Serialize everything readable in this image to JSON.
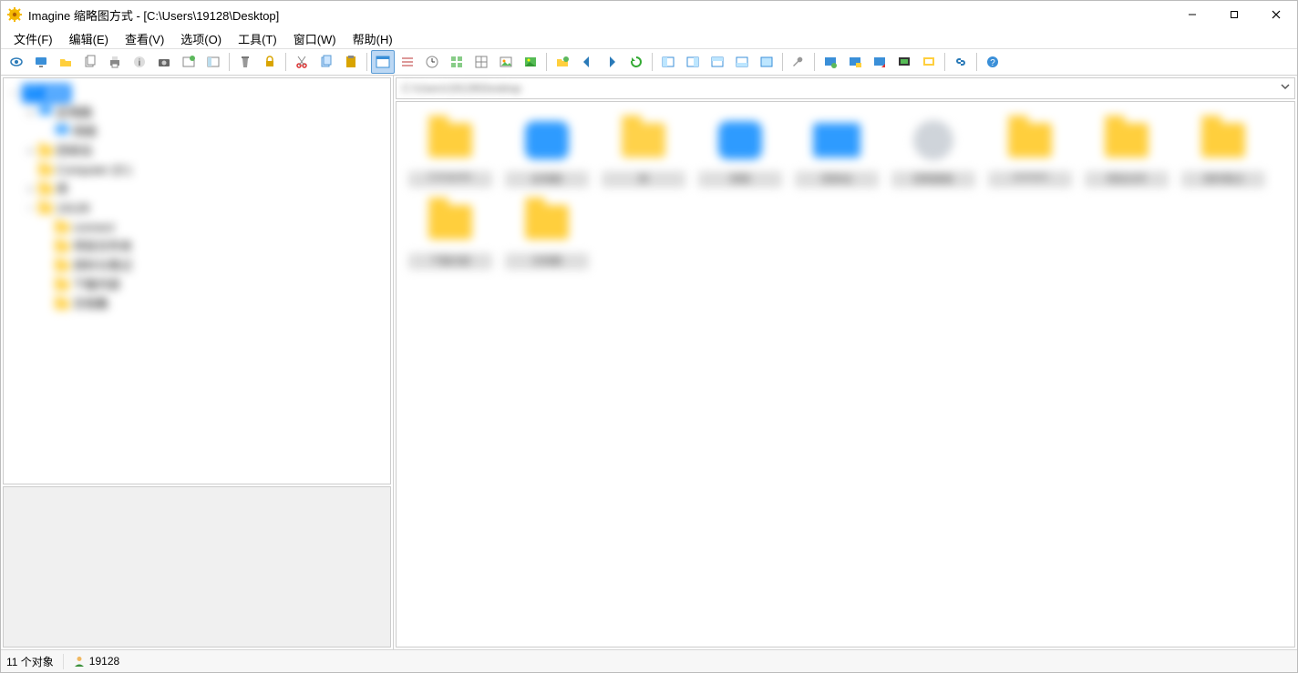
{
  "window": {
    "title": "Imagine 缩略图方式 - [C:\\Users\\19128\\Desktop]"
  },
  "menu": {
    "file": "文件(F)",
    "edit": "编辑(E)",
    "view": "查看(V)",
    "options": "选项(O)",
    "tools": "工具(T)",
    "window": "窗口(W)",
    "help": "帮助(H)"
  },
  "toolbar": {
    "groups": [
      [
        "view-icon",
        "monitor-icon",
        "folder-open-icon",
        "copy-icon",
        "print-icon",
        "info-icon",
        "camera-icon",
        "new-window-icon",
        "panel-icon"
      ],
      [
        "delete-icon",
        "lock-icon"
      ],
      [
        "cut-icon",
        "copy2-icon",
        "paste-icon"
      ],
      [
        "window-mode-icon",
        "list-icon",
        "clock-icon",
        "details-icon",
        "grid-icon",
        "image-icon",
        "scenery-icon"
      ],
      [
        "home-folder-icon",
        "back-icon",
        "forward-icon",
        "refresh-icon"
      ],
      [
        "pane1-icon",
        "pane2-icon",
        "pane3-icon",
        "pane4-icon",
        "pane5-icon"
      ],
      [
        "wrench-icon"
      ],
      [
        "screen1-icon",
        "screen2-icon",
        "screen3-icon",
        "screen4-icon",
        "screen5-icon"
      ],
      [
        "link-icon"
      ],
      [
        "help-icon"
      ]
    ],
    "active": "window-mode-icon"
  },
  "address": {
    "path": "C:\\Users\\19128\\Desktop"
  },
  "tree": {
    "items": [
      {
        "indent": 0,
        "expander": "−",
        "label": "桌面",
        "selected": true,
        "kind": "blue"
      },
      {
        "indent": 1,
        "expander": "+",
        "label": "此电脑",
        "kind": "blue"
      },
      {
        "indent": 2,
        "expander": "",
        "label": "网络",
        "kind": "blue"
      },
      {
        "indent": 1,
        "expander": "+",
        "label": "回收站",
        "kind": "folder"
      },
      {
        "indent": 1,
        "expander": "",
        "label": "Computer (D:)",
        "kind": "folder"
      },
      {
        "indent": 1,
        "expander": "+",
        "label": "库",
        "kind": "folder"
      },
      {
        "indent": 1,
        "expander": "−",
        "label": "19128",
        "kind": "folder"
      },
      {
        "indent": 2,
        "expander": "",
        "label": "connect",
        "kind": "folder"
      },
      {
        "indent": 2,
        "expander": "",
        "label": "项目文件夹",
        "kind": "folder"
      },
      {
        "indent": 2,
        "expander": "",
        "label": "资料与笔记",
        "kind": "folder"
      },
      {
        "indent": 2,
        "expander": "",
        "label": "下载内容",
        "kind": "folder"
      },
      {
        "indent": 2,
        "expander": "",
        "label": "文档集",
        "kind": "folder"
      }
    ]
  },
  "thumbs": {
    "items": [
      {
        "label": "Computer",
        "kind": "folder-person"
      },
      {
        "label": "此电脑",
        "kind": "blue"
      },
      {
        "label": "库",
        "kind": "folder-open"
      },
      {
        "label": "网络",
        "kind": "blue"
      },
      {
        "label": "回收站",
        "kind": "blue-rect"
      },
      {
        "label": "控制面板",
        "kind": "gray"
      },
      {
        "label": "connect",
        "kind": "folder"
      },
      {
        "label": "项目文件",
        "kind": "folder"
      },
      {
        "label": "资料笔记",
        "kind": "folder"
      },
      {
        "label": "下载内容",
        "kind": "folder"
      },
      {
        "label": "文档集",
        "kind": "folder"
      }
    ]
  },
  "status": {
    "count_label": "11 个对象",
    "user": "19128"
  }
}
